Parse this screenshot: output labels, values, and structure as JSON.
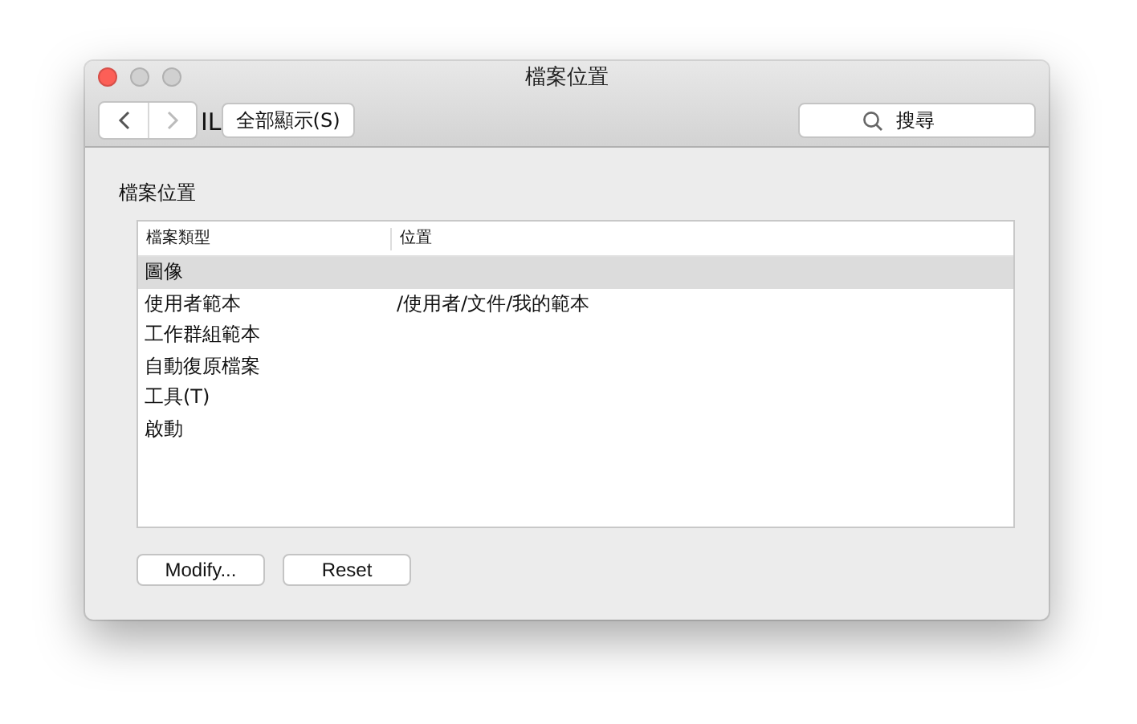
{
  "window": {
    "title": "檔案位置"
  },
  "toolbar": {
    "back_disabled": false,
    "forward_disabled": true,
    "stray_text": "IL",
    "show_all": "全部顯示(S)",
    "search": {
      "placeholder": "搜尋"
    }
  },
  "section": {
    "title": "檔案位置"
  },
  "table": {
    "columns": [
      "檔案類型",
      "位置"
    ],
    "rows": [
      {
        "cells": [
          "圖像",
          ""
        ],
        "selected": true
      },
      {
        "cells": [
          "使用者範本",
          "/使用者/文件/我的範本"
        ],
        "selected": false
      },
      {
        "cells": [
          "工作群組範本",
          ""
        ],
        "selected": false
      },
      {
        "cells": [
          "自動復原檔案",
          ""
        ],
        "selected": false
      },
      {
        "cells": [
          "工具(T)",
          ""
        ],
        "selected": false
      },
      {
        "cells": [
          "啟動",
          ""
        ],
        "selected": false
      }
    ]
  },
  "buttons": [
    "Modify...",
    "Reset"
  ]
}
